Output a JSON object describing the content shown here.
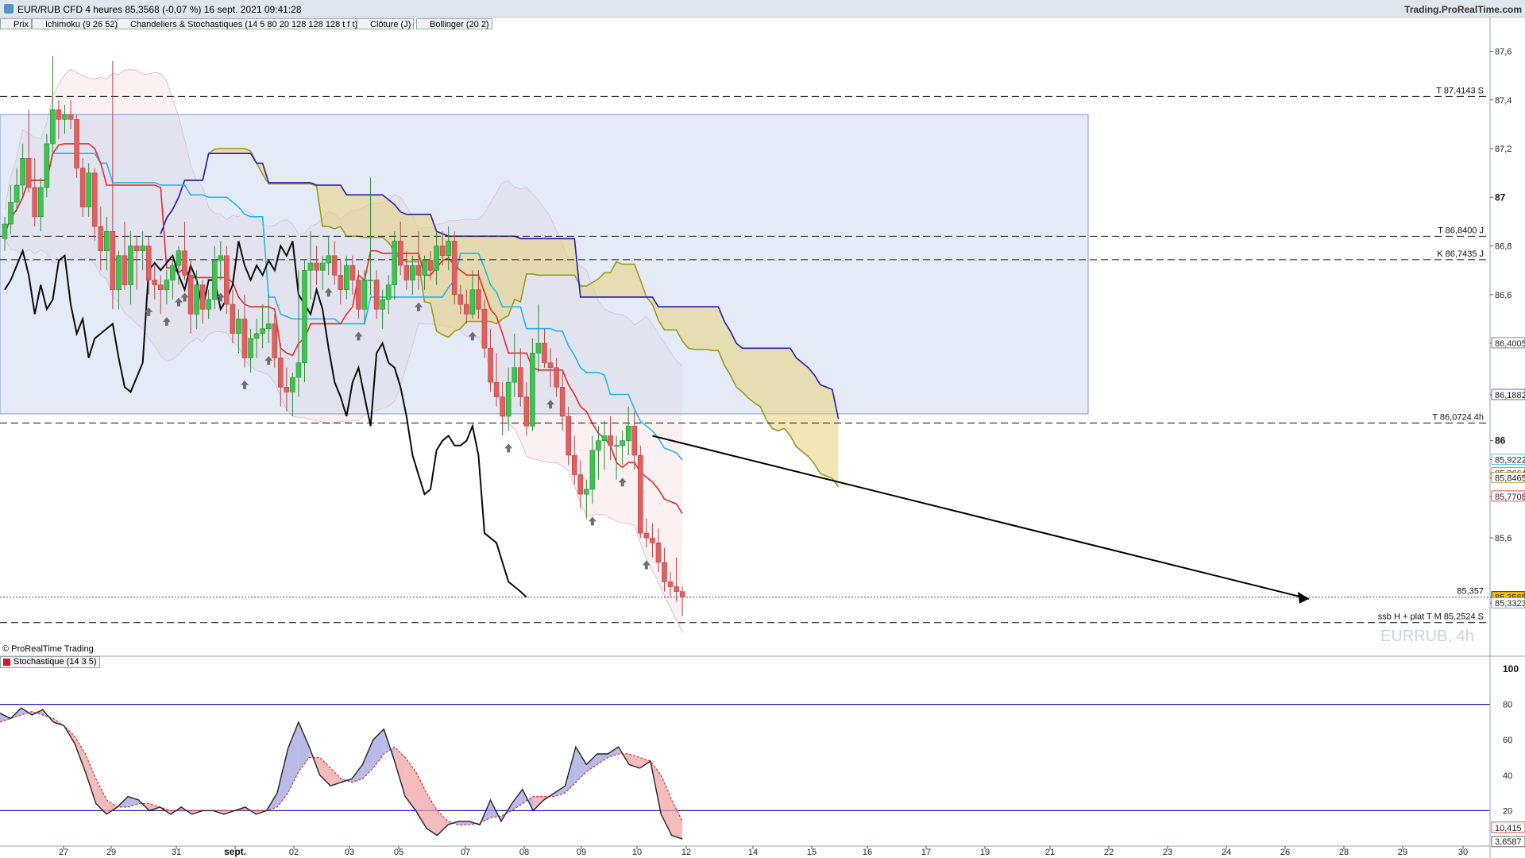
{
  "header": {
    "title": "EUR/RUB CFD 4 heures 85,3568 (-0,07 %) 16 sept. 2021 09:41:28",
    "site": "Trading.ProRealTime.com"
  },
  "legend": [
    {
      "label": "Prix",
      "color": "#1aa34a"
    },
    {
      "label": "Ichimoku (9 26 52)",
      "color": "#333333"
    },
    {
      "label": "Chandeliers & Stochastiques (14 5 80 20 128 128 128 t f t)",
      "color": "#000000"
    },
    {
      "label": "Clôture (J)",
      "color": "#3a3ad8"
    },
    {
      "label": "Bollinger (20 2)",
      "color": "#dddddd"
    }
  ],
  "copyright": "© ProRealTime Trading",
  "watermark": "EURRUB, 4h",
  "stoch_label": "Stochastique (14 3 5)",
  "colors": {
    "up": "#3fc24f",
    "down": "#e0605f",
    "tenkan": "#e8292b",
    "kijun": "#22b6e6",
    "chikou": "#0a0a0a",
    "spanA": "#9a9a1a",
    "spanB": "#2a1ab0",
    "boll": "#e0c0c8",
    "stoch_k": "#222222",
    "stoch_d": "#e02a2a",
    "box": "#c5d2ec"
  },
  "chart_data": [
    {
      "type": "candlestick",
      "title": "EUR/RUB CFD 4 heures",
      "xlabel": "",
      "ylabel": "",
      "ylim": [
        85.16,
        87.68
      ],
      "y_ticks": [
        "87,6",
        "87,4",
        "87,2",
        "87",
        "86,8",
        "86,6",
        "86,4005",
        "86,1882",
        "86",
        "85,9222",
        "85,8664",
        "85,8465",
        "85,7708",
        "85,6",
        "85,3568",
        "85,3323"
      ],
      "x_ticks": [
        "27",
        "29",
        "31",
        "sept.",
        "02",
        "03",
        "05",
        "07",
        "08",
        "09",
        "10",
        "12",
        "14",
        "15",
        "16",
        "17",
        "19",
        "21",
        "22",
        "23",
        "24",
        "26",
        "28",
        "29",
        "30"
      ],
      "levels": [
        {
          "label": "T 87,4143 S",
          "value": 87.4143
        },
        {
          "label": "T 86,8400 J",
          "value": 86.84
        },
        {
          "label": "K 86,7435 J",
          "value": 86.7435
        },
        {
          "label": "T 86,0724 4h",
          "value": 86.0724
        },
        {
          "label": "ssb H + plat T M 85,2524 S",
          "value": 85.2524
        },
        {
          "label": "85,357",
          "value": 85.357
        }
      ],
      "price_box": {
        "from_label": "26",
        "to_label": "22",
        "low": 86.11,
        "high": 87.34
      },
      "trendline": {
        "from": 86.02,
        "to": 85.35
      },
      "last_price": "85,3568",
      "candles": [
        [
          86.83,
          86.92,
          86.78,
          86.89
        ],
        [
          86.89,
          87.05,
          86.85,
          86.98
        ],
        [
          86.98,
          87.12,
          86.94,
          87.05
        ],
        [
          87.05,
          87.22,
          87.01,
          87.16
        ],
        [
          87.16,
          87.36,
          87.02,
          87.04
        ],
        [
          87.04,
          87.16,
          86.88,
          86.92
        ],
        [
          86.92,
          87.08,
          86.86,
          87.04
        ],
        [
          87.04,
          87.26,
          87.0,
          87.22
        ],
        [
          87.22,
          87.58,
          87.18,
          87.36
        ],
        [
          87.36,
          87.4,
          87.24,
          87.32
        ],
        [
          87.32,
          87.38,
          87.26,
          87.34
        ],
        [
          87.34,
          87.4,
          87.28,
          87.32
        ],
        [
          87.32,
          87.34,
          87.08,
          87.12
        ],
        [
          87.12,
          87.16,
          86.92,
          86.96
        ],
        [
          86.96,
          87.14,
          86.92,
          87.1
        ],
        [
          87.1,
          87.12,
          86.82,
          86.88
        ],
        [
          86.88,
          86.96,
          86.7,
          86.78
        ],
        [
          86.78,
          86.92,
          86.7,
          86.86
        ],
        [
          86.86,
          87.56,
          86.54,
          86.62
        ],
        [
          86.62,
          86.78,
          86.54,
          86.76
        ],
        [
          86.76,
          86.9,
          86.62,
          86.64
        ],
        [
          86.64,
          86.86,
          86.56,
          86.8
        ],
        [
          86.8,
          86.84,
          86.62,
          86.78
        ],
        [
          86.78,
          86.86,
          86.7,
          86.8
        ],
        [
          86.8,
          86.84,
          86.6,
          86.66
        ],
        [
          86.66,
          86.72,
          86.58,
          86.64
        ],
        [
          86.64,
          86.68,
          86.52,
          86.62
        ],
        [
          86.62,
          86.7,
          86.56,
          86.66
        ],
        [
          86.66,
          86.76,
          86.58,
          86.72
        ],
        [
          86.72,
          86.8,
          86.64,
          86.78
        ],
        [
          86.78,
          86.9,
          86.66,
          86.68
        ],
        [
          86.68,
          86.74,
          86.44,
          86.52
        ],
        [
          86.52,
          86.7,
          86.46,
          86.64
        ],
        [
          86.64,
          86.66,
          86.48,
          86.54
        ],
        [
          86.54,
          86.62,
          86.5,
          86.58
        ],
        [
          86.58,
          86.8,
          86.54,
          86.74
        ],
        [
          86.74,
          86.82,
          86.66,
          86.76
        ],
        [
          86.76,
          86.8,
          86.52,
          86.56
        ],
        [
          86.56,
          86.62,
          86.4,
          86.44
        ],
        [
          86.44,
          86.54,
          86.36,
          86.5
        ],
        [
          86.5,
          86.6,
          86.3,
          86.34
        ],
        [
          86.34,
          86.46,
          86.28,
          86.42
        ],
        [
          86.42,
          86.5,
          86.34,
          86.44
        ],
        [
          86.44,
          86.56,
          86.38,
          86.46
        ],
        [
          86.46,
          86.6,
          86.4,
          86.48
        ],
        [
          86.48,
          86.52,
          86.3,
          86.34
        ],
        [
          86.34,
          86.4,
          86.14,
          86.22
        ],
        [
          86.22,
          86.3,
          86.12,
          86.2
        ],
        [
          86.2,
          86.28,
          86.1,
          86.26
        ],
        [
          86.26,
          86.7,
          86.18,
          86.32
        ],
        [
          86.32,
          86.74,
          86.24,
          86.7
        ],
        [
          86.7,
          86.86,
          86.58,
          86.73
        ],
        [
          86.73,
          86.8,
          86.64,
          86.7
        ],
        [
          86.7,
          86.76,
          86.62,
          86.73
        ],
        [
          86.73,
          86.84,
          86.68,
          86.76
        ],
        [
          86.76,
          86.82,
          86.64,
          86.68
        ],
        [
          86.68,
          86.74,
          86.56,
          86.62
        ],
        [
          86.62,
          86.76,
          86.58,
          86.72
        ],
        [
          86.72,
          86.76,
          86.6,
          86.66
        ],
        [
          86.66,
          86.7,
          86.5,
          86.54
        ],
        [
          86.54,
          86.7,
          86.48,
          86.66
        ],
        [
          86.66,
          87.08,
          86.6,
          86.66
        ],
        [
          86.66,
          86.7,
          86.5,
          86.54
        ],
        [
          86.54,
          86.62,
          86.46,
          86.58
        ],
        [
          86.58,
          86.68,
          86.52,
          86.64
        ],
        [
          86.64,
          86.86,
          86.58,
          86.82
        ],
        [
          86.82,
          86.9,
          86.68,
          86.72
        ],
        [
          86.72,
          86.78,
          86.62,
          86.66
        ],
        [
          86.66,
          86.76,
          86.6,
          86.72
        ],
        [
          86.72,
          86.86,
          86.62,
          86.68
        ],
        [
          86.68,
          86.76,
          86.62,
          86.74
        ],
        [
          86.74,
          86.78,
          86.66,
          86.7
        ],
        [
          86.7,
          86.86,
          86.64,
          86.8
        ],
        [
          86.8,
          86.86,
          86.72,
          86.76
        ],
        [
          86.76,
          86.88,
          86.7,
          86.82
        ],
        [
          86.82,
          86.86,
          86.56,
          86.6
        ],
        [
          86.6,
          86.64,
          86.52,
          86.56
        ],
        [
          86.56,
          86.62,
          86.48,
          86.52
        ],
        [
          86.52,
          86.7,
          86.5,
          86.62
        ],
        [
          86.62,
          86.7,
          86.5,
          86.54
        ],
        [
          86.54,
          86.58,
          86.34,
          86.38
        ],
        [
          86.38,
          86.46,
          86.2,
          86.24
        ],
        [
          86.24,
          86.36,
          86.14,
          86.18
        ],
        [
          86.18,
          86.24,
          86.02,
          86.1
        ],
        [
          86.1,
          86.3,
          86.04,
          86.24
        ],
        [
          86.24,
          86.44,
          86.18,
          86.3
        ],
        [
          86.3,
          86.38,
          86.14,
          86.18
        ],
        [
          86.18,
          86.24,
          86.02,
          86.06
        ],
        [
          86.06,
          86.42,
          86.04,
          86.36
        ],
        [
          86.36,
          86.56,
          86.28,
          86.4
        ],
        [
          86.4,
          86.46,
          86.3,
          86.32
        ],
        [
          86.32,
          86.38,
          86.22,
          86.3
        ],
        [
          86.3,
          86.34,
          86.18,
          86.22
        ],
        [
          86.22,
          86.28,
          86.04,
          86.1
        ],
        [
          86.1,
          86.14,
          85.9,
          85.94
        ],
        [
          85.94,
          86.02,
          85.82,
          85.86
        ],
        [
          85.86,
          85.92,
          85.72,
          85.78
        ],
        [
          85.78,
          85.84,
          85.68,
          85.8
        ],
        [
          85.8,
          86.02,
          85.74,
          85.96
        ],
        [
          85.96,
          86.06,
          85.84,
          86.0
        ],
        [
          86.0,
          86.08,
          85.88,
          86.02
        ],
        [
          86.02,
          86.1,
          85.92,
          85.98
        ],
        [
          85.98,
          86.02,
          85.84,
          85.98
        ],
        [
          85.98,
          86.04,
          85.9,
          86.0
        ],
        [
          86.0,
          86.14,
          85.94,
          86.06
        ],
        [
          86.06,
          86.12,
          85.88,
          85.94
        ],
        [
          85.94,
          85.98,
          85.6,
          85.62
        ],
        [
          85.62,
          85.68,
          85.56,
          85.6
        ],
        [
          85.6,
          85.66,
          85.52,
          85.58
        ],
        [
          85.58,
          85.64,
          85.46,
          85.5
        ],
        [
          85.5,
          85.56,
          85.38,
          85.42
        ],
        [
          85.42,
          85.46,
          85.36,
          85.4
        ],
        [
          85.4,
          85.52,
          85.34,
          85.38
        ],
        [
          85.38,
          85.4,
          85.28,
          85.357
        ]
      ]
    },
    {
      "type": "line",
      "title": "Stochastique (14 3 5)",
      "ylim": [
        0,
        100
      ],
      "y_ticks": [
        "100",
        "80",
        "60",
        "40",
        "20",
        "10,415",
        "3,6587"
      ],
      "levels": [
        80,
        20
      ],
      "k": [
        75,
        72,
        78,
        74,
        77,
        70,
        68,
        58,
        42,
        24,
        18,
        22,
        28,
        26,
        20,
        22,
        18,
        22,
        18,
        20,
        20,
        18,
        20,
        22,
        18,
        20,
        30,
        55,
        70,
        56,
        40,
        34,
        36,
        38,
        46,
        60,
        66,
        48,
        28,
        20,
        10,
        6,
        12,
        14,
        14,
        12,
        26,
        14,
        24,
        32,
        20,
        26,
        30,
        34,
        56,
        46,
        52,
        52,
        56,
        46,
        44,
        48,
        18,
        6,
        4
      ],
      "d": [
        70,
        72,
        74,
        76,
        74,
        72,
        68,
        62,
        52,
        38,
        26,
        22,
        22,
        24,
        24,
        22,
        20,
        20,
        20,
        20,
        20,
        20,
        20,
        20,
        20,
        20,
        22,
        30,
        42,
        50,
        50,
        44,
        38,
        36,
        38,
        44,
        52,
        56,
        50,
        42,
        30,
        20,
        14,
        12,
        12,
        13,
        16,
        17,
        20,
        24,
        28,
        28,
        28,
        30,
        36,
        42,
        46,
        50,
        52,
        52,
        50,
        48,
        40,
        26,
        14
      ]
    }
  ]
}
